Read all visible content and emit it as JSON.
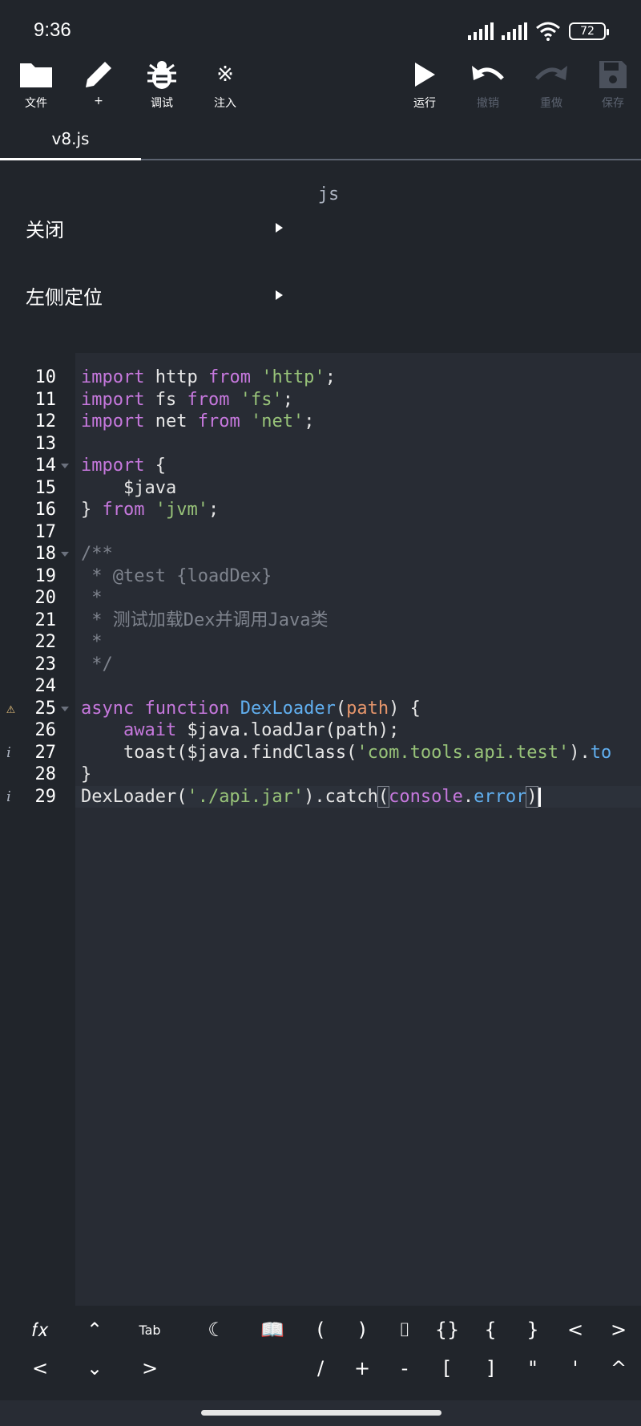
{
  "status": {
    "time": "9:36",
    "battery": "72"
  },
  "toolbar": {
    "file": "文件",
    "new": "+",
    "debug": "调试",
    "inject": "注入",
    "run": "运行",
    "undo": "撤销",
    "redo": "重做",
    "save": "保存"
  },
  "tab": {
    "name": "v8.js"
  },
  "menu": {
    "header": "js",
    "items": [
      {
        "label": "关闭"
      },
      {
        "label": "左侧定位"
      }
    ]
  },
  "editor": {
    "lines": [
      {
        "num": "10",
        "parts": [
          [
            "kw",
            "import"
          ],
          [
            "pl",
            " http "
          ],
          [
            "kw",
            "from"
          ],
          [
            "pl",
            " "
          ],
          [
            "str",
            "'http'"
          ],
          [
            "pl",
            ";"
          ]
        ]
      },
      {
        "num": "11",
        "parts": [
          [
            "kw",
            "import"
          ],
          [
            "pl",
            " fs "
          ],
          [
            "kw",
            "from"
          ],
          [
            "pl",
            " "
          ],
          [
            "str",
            "'fs'"
          ],
          [
            "pl",
            ";"
          ]
        ]
      },
      {
        "num": "12",
        "parts": [
          [
            "kw",
            "import"
          ],
          [
            "pl",
            " net "
          ],
          [
            "kw",
            "from"
          ],
          [
            "pl",
            " "
          ],
          [
            "str",
            "'net'"
          ],
          [
            "pl",
            ";"
          ]
        ]
      },
      {
        "num": "13",
        "parts": []
      },
      {
        "num": "14",
        "fold": true,
        "parts": [
          [
            "kw",
            "import"
          ],
          [
            "pl",
            " {"
          ]
        ]
      },
      {
        "num": "15",
        "parts": [
          [
            "pl",
            "    $java"
          ]
        ]
      },
      {
        "num": "16",
        "parts": [
          [
            "pl",
            "} "
          ],
          [
            "kw",
            "from"
          ],
          [
            "pl",
            " "
          ],
          [
            "str",
            "'jvm'"
          ],
          [
            "pl",
            ";"
          ]
        ]
      },
      {
        "num": "17",
        "parts": []
      },
      {
        "num": "18",
        "fold": true,
        "parts": [
          [
            "cm",
            "/**"
          ]
        ]
      },
      {
        "num": "19",
        "parts": [
          [
            "cm",
            " * @test {loadDex}"
          ]
        ]
      },
      {
        "num": "20",
        "parts": [
          [
            "cm",
            " *"
          ]
        ]
      },
      {
        "num": "21",
        "parts": [
          [
            "cm",
            " * 测试加载Dex并调用Java类"
          ]
        ]
      },
      {
        "num": "22",
        "parts": [
          [
            "cm",
            " *"
          ]
        ]
      },
      {
        "num": "23",
        "parts": [
          [
            "cm",
            " */"
          ]
        ]
      },
      {
        "num": "24",
        "parts": []
      },
      {
        "num": "25",
        "fold": true,
        "mark": "warn",
        "parts": [
          [
            "kw",
            "async"
          ],
          [
            "pl",
            " "
          ],
          [
            "kw",
            "function"
          ],
          [
            "pl",
            " "
          ],
          [
            "fn",
            "DexLoader"
          ],
          [
            "pl",
            "("
          ],
          [
            "param",
            "path"
          ],
          [
            "pl",
            ") {"
          ]
        ]
      },
      {
        "num": "26",
        "parts": [
          [
            "pl",
            "    "
          ],
          [
            "kw",
            "await"
          ],
          [
            "pl",
            " $java.loadJar(path);"
          ]
        ]
      },
      {
        "num": "27",
        "mark": "info",
        "parts": [
          [
            "pl",
            "    toast($java.findClass("
          ],
          [
            "str",
            "'com.tools.api.test'"
          ],
          [
            "pl",
            ")."
          ],
          [
            "fn",
            "to"
          ]
        ]
      },
      {
        "num": "28",
        "parts": [
          [
            "pl",
            "}"
          ]
        ]
      },
      {
        "num": "29",
        "mark": "info",
        "current": true,
        "parts": [
          [
            "pl",
            "DexLoader("
          ],
          [
            "str",
            "'./api.jar'"
          ],
          [
            "pl",
            ").catch"
          ],
          [
            "hl",
            "("
          ],
          [
            "kw",
            "console"
          ],
          [
            "pl",
            "."
          ],
          [
            "fn",
            "error"
          ],
          [
            "hl",
            ")"
          ]
        ]
      }
    ]
  },
  "keyboard": {
    "row1": [
      "𝑓𝑥",
      "⌃",
      "Tab",
      "☾",
      "📖",
      "(",
      ")",
      "⌷",
      "{}",
      "{",
      "}",
      "<",
      ">"
    ],
    "row2": [
      "<",
      "⌄",
      ">",
      "/",
      "+",
      "-",
      "[",
      "]",
      "\"",
      "'",
      "^"
    ]
  }
}
